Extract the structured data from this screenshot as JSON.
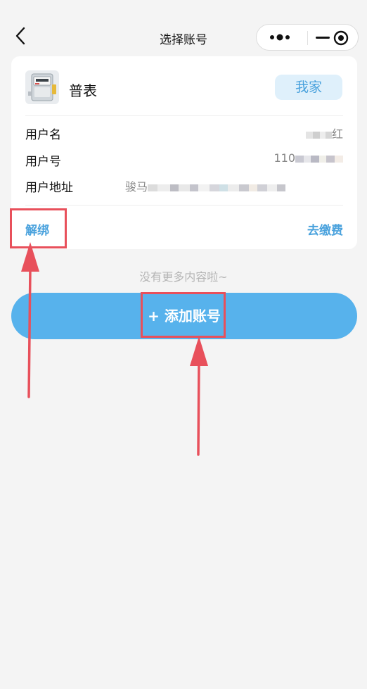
{
  "header": {
    "title": "选择账号"
  },
  "card": {
    "meter_type": "普表",
    "tag": "我家",
    "rows": [
      {
        "label": "用户名",
        "value": "红"
      },
      {
        "label": "用户号",
        "value": "110"
      },
      {
        "label": "用户地址",
        "value": "骏马"
      }
    ],
    "unbind_label": "解绑",
    "pay_label": "去缴费"
  },
  "footer_note": "没有更多内容啦~",
  "add_button_label": "+ 添加账号",
  "colors": {
    "accent": "#57b2ec",
    "link": "#4aa2dd",
    "annotation": "#e8505b"
  }
}
